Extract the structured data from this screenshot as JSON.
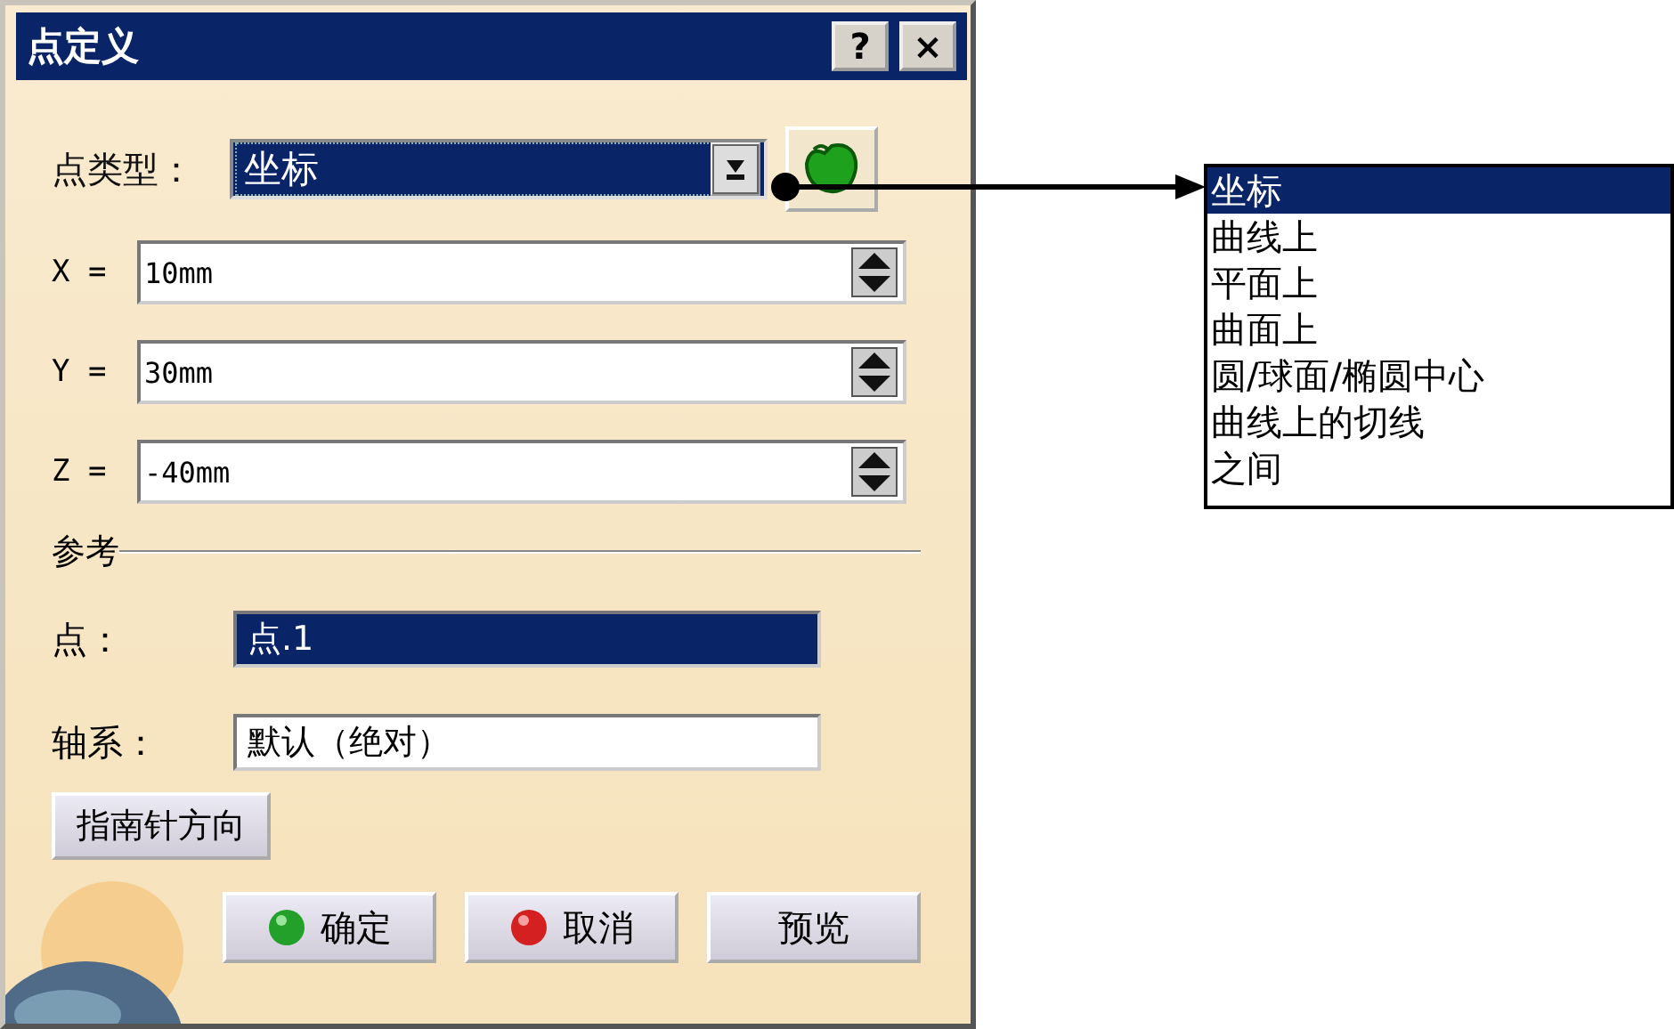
{
  "window": {
    "title": "点定义",
    "buttons": [
      "?",
      "×"
    ]
  },
  "point_type": {
    "label": "点类型：",
    "value": "坐标"
  },
  "coordinates": [
    {
      "label": "X =",
      "value": "10mm"
    },
    {
      "label": "Y =",
      "value": "30mm"
    },
    {
      "label": "Z =",
      "value": "-40mm"
    }
  ],
  "reference": {
    "title": "参考",
    "point": {
      "label": "点：",
      "value": "点.1",
      "selected": true
    },
    "axis": {
      "label": "轴系：",
      "value": "默认（绝对）",
      "selected": false
    }
  },
  "compass_button": "指南针方向",
  "buttons": [
    {
      "label": "确定",
      "kind": "ok"
    },
    {
      "label": "取消",
      "kind": "cancel"
    },
    {
      "label": "预览",
      "kind": "plain"
    }
  ],
  "dropdown_list": [
    {
      "label": "坐标",
      "selected": true
    },
    {
      "label": "曲线上",
      "selected": false
    },
    {
      "label": "平面上",
      "selected": false
    },
    {
      "label": "曲面上",
      "selected": false
    },
    {
      "label": "圆/球面/椭圆中心",
      "selected": false
    },
    {
      "label": "曲线上的切线",
      "selected": false
    },
    {
      "label": "之间",
      "selected": false
    }
  ]
}
